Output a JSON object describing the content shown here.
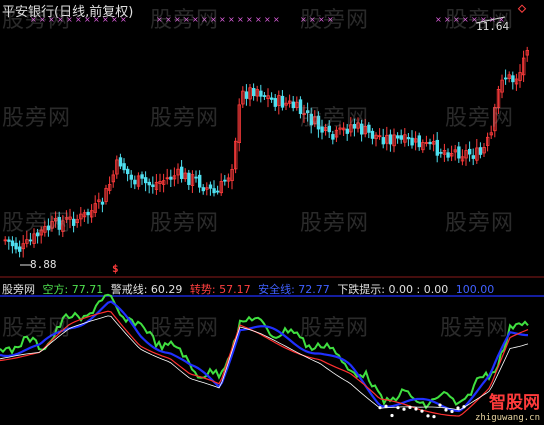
{
  "header": {
    "title": "平安银行(日线,前复权)"
  },
  "price_panel": {
    "high_label": "11.64",
    "low_label": "8.88",
    "colors": {
      "up": "#ff3b3b",
      "down": "#4fe0f0",
      "marker": "#e060e0"
    }
  },
  "indicator_panel": {
    "name": "股旁网",
    "items": [
      {
        "label": "空方: 77.71",
        "color": "#4fe04f"
      },
      {
        "label": "警戒线: 60.29",
        "color": "#e0e0e0"
      },
      {
        "label": "转势: 57.17",
        "color": "#ff4040"
      },
      {
        "label": "安全线: 72.77",
        "color": "#4060ff"
      },
      {
        "label": "下跌提示: 0.00 : 0.00",
        "color": "#e0e0e0"
      },
      {
        "label": "100.00",
        "color": "#4060ff"
      }
    ],
    "signal_label": "$",
    "colors": {
      "green_line": "#40e040",
      "blue_line": "#2030ff",
      "red_line": "#ff3030",
      "white_line": "#ffffff"
    }
  },
  "watermark": {
    "text": "股旁网"
  },
  "brand": {
    "main": "智股网",
    "sub": "zhiguwang.cn"
  }
}
